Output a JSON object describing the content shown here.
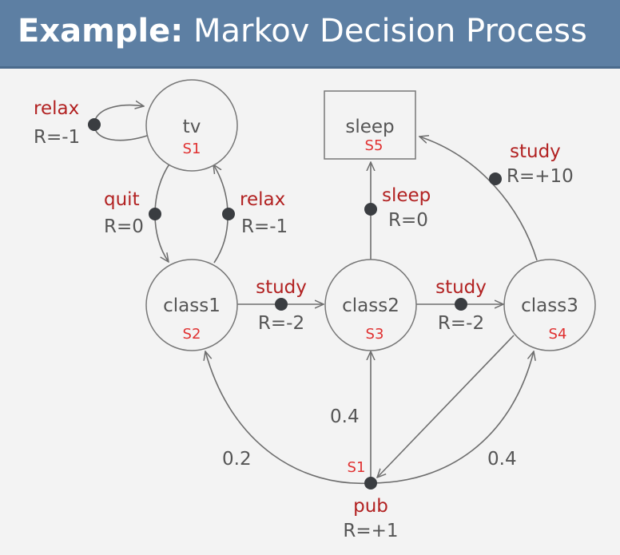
{
  "header": {
    "title_bold": "Example:",
    "title_rest": "Markov Decision Process"
  },
  "nodes": {
    "tv": {
      "name": "tv",
      "state": "S1"
    },
    "class1": {
      "name": "class1",
      "state": "S2"
    },
    "class2": {
      "name": "class2",
      "state": "S3"
    },
    "class3": {
      "name": "class3",
      "state": "S4"
    },
    "sleep": {
      "name": "sleep",
      "state": "S5"
    },
    "pub": {
      "name": "pub",
      "state": "S1",
      "reward": "R=+1"
    }
  },
  "actions": {
    "tv_relax": {
      "action": "relax",
      "reward": "R=-1"
    },
    "tv_quit": {
      "action": "quit",
      "reward": "R=0"
    },
    "class1_relax": {
      "action": "relax",
      "reward": "R=-1"
    },
    "class1_study": {
      "action": "study",
      "reward": "R=-2"
    },
    "class2_study": {
      "action": "study",
      "reward": "R=-2"
    },
    "class2_sleep": {
      "action": "sleep",
      "reward": "R=0"
    },
    "class3_study": {
      "action": "study",
      "reward": "R=+10"
    }
  },
  "probabilities": {
    "pub_to_class1": "0.2",
    "pub_to_class2": "0.4",
    "pub_to_class3": "0.4"
  },
  "colors": {
    "header": "#5d7fa3",
    "background": "#f3f3f3",
    "action_label": "#b22222",
    "state_label": "#e03030",
    "dot": "#3a3d41"
  }
}
